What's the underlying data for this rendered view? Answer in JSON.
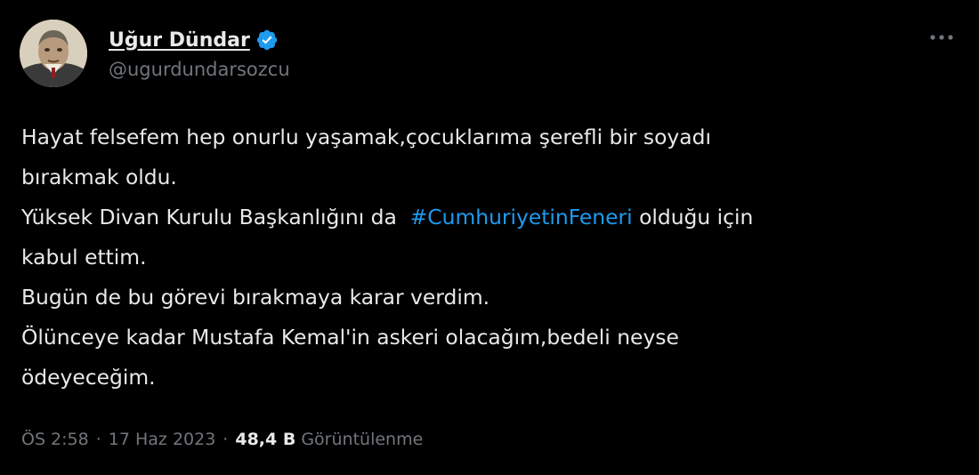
{
  "author": {
    "display_name": "Uğur Dündar",
    "handle": "@ugurdundarsozcu",
    "verified": true,
    "avatar_icon": "profile-photo"
  },
  "tweet": {
    "lines": [
      {
        "text": "Hayat felsefem hep onurlu yaşamak,çocuklarıma şerefli bir soyadı"
      },
      {
        "text": "bırakmak oldu."
      },
      {
        "before": "Yüksek Divan Kurulu Başkanlığını da  ",
        "hashtag": "#CumhuriyetinFeneri",
        "after": " olduğu için"
      },
      {
        "text": "kabul ettim."
      },
      {
        "text": "Bugün de bu görevi bırakmaya karar verdim."
      },
      {
        "text": "Ölünceye kadar Mustafa Kemal'in askeri olacağım,bedeli neyse"
      },
      {
        "text": "ödeyeceğim."
      }
    ]
  },
  "meta": {
    "time": "ÖS 2:58",
    "separator": "·",
    "date": "17 Haz 2023",
    "views_count": "48,4 B",
    "views_label": "Görüntülenme"
  },
  "colors": {
    "background": "#000000",
    "text": "#e7e9ea",
    "secondary": "#71767b",
    "link": "#1d9bf0",
    "verified": "#1d9bf0"
  },
  "icons": {
    "verified": "verified-badge-icon",
    "more": "more-options-icon"
  }
}
